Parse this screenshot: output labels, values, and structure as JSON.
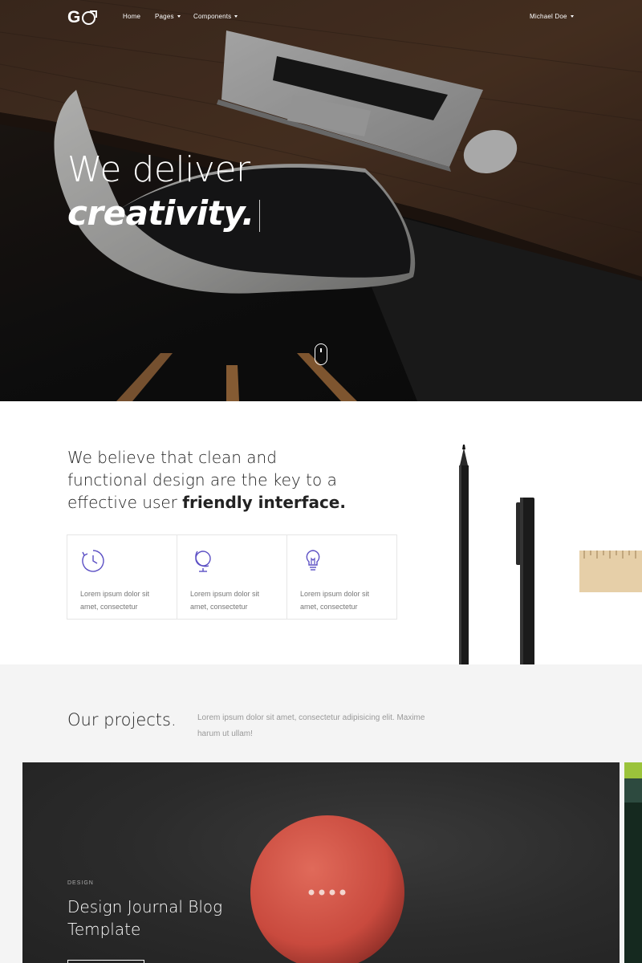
{
  "nav": {
    "logo": "GO",
    "links": [
      {
        "label": "Home"
      },
      {
        "label": "Pages"
      },
      {
        "label": "Components"
      }
    ],
    "user": "Michael Doe"
  },
  "hero": {
    "line1": "We deliver",
    "line2": "creativity."
  },
  "about": {
    "heading_regular": "We believe that clean and functional design are the key to a effective user ",
    "heading_bold": "friendly interface.",
    "features": [
      {
        "icon": "clock-icon",
        "text": "Lorem ipsum dolor sit amet, consectetur"
      },
      {
        "icon": "globe-icon",
        "text": "Lorem ipsum dolor sit amet, consectetur"
      },
      {
        "icon": "lightbulb-icon",
        "text": "Lorem ipsum dolor sit amet, consectetur"
      }
    ]
  },
  "projects": {
    "title": "Our projects.",
    "description": "Lorem ipsum dolor sit amet, consectetur adipisicing elit. Maxime harum ut ullam!",
    "card": {
      "category": "DESIGN",
      "title": "Design Journal Blog Template"
    }
  },
  "colors": {
    "accent": "#5b4fc4",
    "hero_bg": "#121212",
    "projects_bg": "#f4f4f4"
  }
}
